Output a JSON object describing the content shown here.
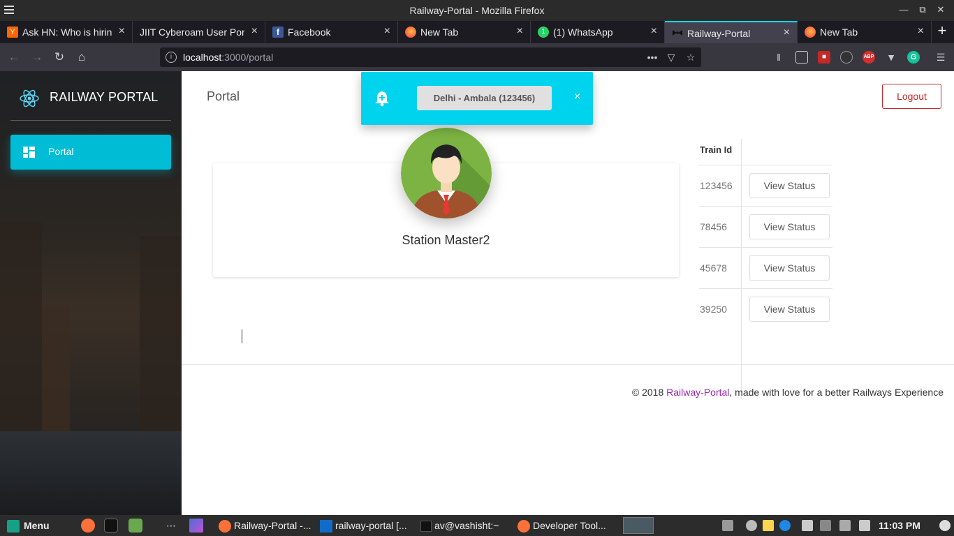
{
  "window": {
    "title": "Railway-Portal - Mozilla Firefox"
  },
  "tabs": [
    {
      "label": "Ask HN: Who is hiring",
      "favicon": "y-combinator-icon",
      "color": "#ff6600"
    },
    {
      "label": "JIIT Cyberoam User Port",
      "favicon": "none",
      "color": ""
    },
    {
      "label": "Facebook",
      "favicon": "facebook-icon",
      "color": "#3b5998"
    },
    {
      "label": "New Tab",
      "favicon": "firefox-icon",
      "color": "#ff7139"
    },
    {
      "label": "(1) WhatsApp",
      "favicon": "whatsapp-icon",
      "color": "#25d366"
    },
    {
      "label": "Railway-Portal",
      "favicon": "bow-tie-icon",
      "color": "#111111",
      "active": true
    },
    {
      "label": "New Tab",
      "favicon": "firefox-icon",
      "color": "#ff7139"
    }
  ],
  "url": {
    "host": "localhost",
    "path": ":3000/portal"
  },
  "sidebar": {
    "brand": "RAILWAY PORTAL",
    "items": [
      {
        "label": "Portal",
        "icon": "dashboard-icon"
      }
    ]
  },
  "header": {
    "title": "Portal",
    "logout_label": "Logout"
  },
  "profile": {
    "name": "Station Master2"
  },
  "trains": {
    "header": "Train Id",
    "rows": [
      {
        "id": "123456",
        "action": "View Status"
      },
      {
        "id": "78456",
        "action": "View Status"
      },
      {
        "id": "45678",
        "action": "View Status"
      },
      {
        "id": "39250",
        "action": "View Status"
      }
    ]
  },
  "notification": {
    "message": "Delhi - Ambala (123456)",
    "close": "×"
  },
  "footer": {
    "prefix": "© 2018 ",
    "link": "Railway-Portal",
    "suffix": ", made with love for a better Railways Experience"
  },
  "taskbar": {
    "menu": "Menu",
    "apps": [
      {
        "label": "Railway-Portal -...",
        "icon": "firefox-icon"
      },
      {
        "label": "railway-portal [...",
        "icon": "webstorm-icon"
      },
      {
        "label": "av@vashisht:~",
        "icon": "terminal-icon"
      },
      {
        "label": "Developer Tool...",
        "icon": "firefox-icon"
      }
    ],
    "clock": "11:03 PM"
  },
  "colors": {
    "accent": "#00bcd4",
    "notify": "#00d3ee",
    "logout": "#c62828",
    "link": "#9c27b0"
  }
}
